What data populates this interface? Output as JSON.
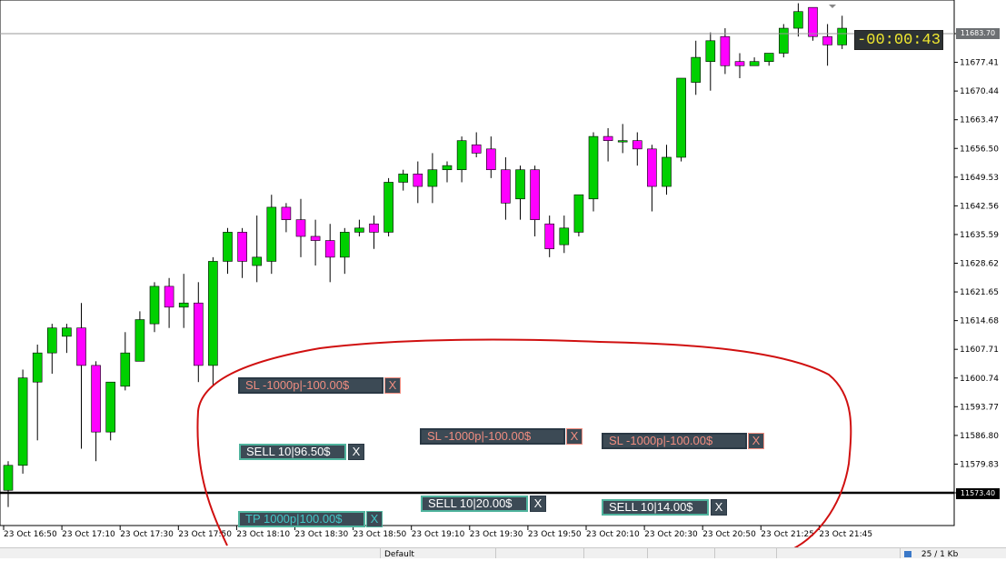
{
  "chart": {
    "price_ticks": [
      "11683.70",
      "11677.41",
      "11670.44",
      "11663.47",
      "11656.50",
      "11649.53",
      "11642.56",
      "11635.59",
      "11628.62",
      "11621.65",
      "11614.68",
      "11607.71",
      "11600.74",
      "11593.77",
      "11586.80",
      "11579.83",
      "11573.40"
    ],
    "time_ticks": [
      "23 Oct 16:50",
      "23 Oct 17:10",
      "23 Oct 17:30",
      "23 Oct 17:50",
      "23 Oct 18:10",
      "23 Oct 18:30",
      "23 Oct 18:50",
      "23 Oct 19:10",
      "23 Oct 19:30",
      "23 Oct 19:50",
      "23 Oct 20:10",
      "23 Oct 20:30",
      "23 Oct 20:50",
      "23 Oct 21:25",
      "23 Oct 21:45"
    ],
    "bid_price": "11683.70",
    "last_price": "11573.40",
    "countdown": "-00:00:43",
    "colors": {
      "bull": "#00d000",
      "bear": "#ff00ff",
      "annotation": "#d01010"
    }
  },
  "chart_data": {
    "type": "candlestick",
    "y_range": [
      11573.4,
      11683.7
    ],
    "candles": [
      {
        "o": 11574,
        "h": 11581,
        "l": 11570,
        "c": 11580
      },
      {
        "o": 11580,
        "h": 11603,
        "l": 11578,
        "c": 11601
      },
      {
        "o": 11600,
        "h": 11609,
        "l": 11586,
        "c": 11607
      },
      {
        "o": 11607,
        "h": 11614,
        "l": 11602,
        "c": 11613
      },
      {
        "o": 11611,
        "h": 11614,
        "l": 11607,
        "c": 11613
      },
      {
        "o": 11613,
        "h": 11619,
        "l": 11584,
        "c": 11604
      },
      {
        "o": 11604,
        "h": 11605,
        "l": 11581,
        "c": 11588
      },
      {
        "o": 11588,
        "h": 11600,
        "l": 11586,
        "c": 11600
      },
      {
        "o": 11599,
        "h": 11612,
        "l": 11598,
        "c": 11607
      },
      {
        "o": 11605,
        "h": 11617,
        "l": 11605,
        "c": 11615
      },
      {
        "o": 11614,
        "h": 11624,
        "l": 11612,
        "c": 11623
      },
      {
        "o": 11623,
        "h": 11625,
        "l": 11613,
        "c": 11618
      },
      {
        "o": 11618,
        "h": 11626,
        "l": 11613,
        "c": 11619
      },
      {
        "o": 11619,
        "h": 11624,
        "l": 11600,
        "c": 11604
      },
      {
        "o": 11604,
        "h": 11630,
        "l": 11599,
        "c": 11629
      },
      {
        "o": 11629,
        "h": 11637,
        "l": 11626,
        "c": 11636
      },
      {
        "o": 11636,
        "h": 11637,
        "l": 11625,
        "c": 11629
      },
      {
        "o": 11628,
        "h": 11640,
        "l": 11624,
        "c": 11630
      },
      {
        "o": 11629,
        "h": 11645,
        "l": 11626,
        "c": 11642
      },
      {
        "o": 11642,
        "h": 11643,
        "l": 11636,
        "c": 11639
      },
      {
        "o": 11639,
        "h": 11644,
        "l": 11630,
        "c": 11635
      },
      {
        "o": 11635,
        "h": 11639,
        "l": 11628,
        "c": 11634
      },
      {
        "o": 11634,
        "h": 11638,
        "l": 11624,
        "c": 11630
      },
      {
        "o": 11630,
        "h": 11637,
        "l": 11626,
        "c": 11636
      },
      {
        "o": 11636,
        "h": 11639,
        "l": 11635,
        "c": 11637
      },
      {
        "o": 11638,
        "h": 11640,
        "l": 11632,
        "c": 11636
      },
      {
        "o": 11636,
        "h": 11649,
        "l": 11635,
        "c": 11648
      },
      {
        "o": 11648,
        "h": 11651,
        "l": 11646,
        "c": 11650
      },
      {
        "o": 11650,
        "h": 11653,
        "l": 11643,
        "c": 11647
      },
      {
        "o": 11647,
        "h": 11655,
        "l": 11643,
        "c": 11651
      },
      {
        "o": 11651,
        "h": 11653,
        "l": 11648,
        "c": 11652
      },
      {
        "o": 11651,
        "h": 11659,
        "l": 11648,
        "c": 11658
      },
      {
        "o": 11657,
        "h": 11660,
        "l": 11654,
        "c": 11655
      },
      {
        "o": 11656,
        "h": 11659,
        "l": 11649,
        "c": 11651
      },
      {
        "o": 11651,
        "h": 11654,
        "l": 11639,
        "c": 11643
      },
      {
        "o": 11644,
        "h": 11652,
        "l": 11639,
        "c": 11651
      },
      {
        "o": 11651,
        "h": 11652,
        "l": 11635,
        "c": 11639
      },
      {
        "o": 11638,
        "h": 11640,
        "l": 11630,
        "c": 11632
      },
      {
        "o": 11633,
        "h": 11640,
        "l": 11631,
        "c": 11637
      },
      {
        "o": 11636,
        "h": 11645,
        "l": 11635,
        "c": 11645
      },
      {
        "o": 11644,
        "h": 11660,
        "l": 11641,
        "c": 11659
      },
      {
        "o": 11659,
        "h": 11661,
        "l": 11653,
        "c": 11658
      },
      {
        "o": 11658,
        "h": 11662,
        "l": 11655,
        "c": 11658
      },
      {
        "o": 11658,
        "h": 11660,
        "l": 11652,
        "c": 11656
      },
      {
        "o": 11656,
        "h": 11657,
        "l": 11641,
        "c": 11647
      },
      {
        "o": 11647,
        "h": 11657,
        "l": 11645,
        "c": 11654
      },
      {
        "o": 11654,
        "h": 11673,
        "l": 11653,
        "c": 11673
      },
      {
        "o": 11672,
        "h": 11682,
        "l": 11669,
        "c": 11678
      },
      {
        "o": 11677,
        "h": 11684,
        "l": 11670,
        "c": 11682
      },
      {
        "o": 11683,
        "h": 11685,
        "l": 11674,
        "c": 11676
      },
      {
        "o": 11677,
        "h": 11679,
        "l": 11673,
        "c": 11676
      },
      {
        "o": 11676,
        "h": 11678,
        "l": 11676,
        "c": 11677
      },
      {
        "o": 11677,
        "h": 11678,
        "l": 11676,
        "c": 11679
      },
      {
        "o": 11679,
        "h": 11686,
        "l": 11678,
        "c": 11685
      },
      {
        "o": 11685,
        "h": 11691,
        "l": 11683,
        "c": 11689
      },
      {
        "o": 11690,
        "h": 11690,
        "l": 11682,
        "c": 11683
      },
      {
        "o": 11683,
        "h": 11686,
        "l": 11676,
        "c": 11681
      },
      {
        "o": 11681,
        "h": 11688,
        "l": 11680,
        "c": 11685
      }
    ]
  },
  "overlays": {
    "sl_labels": [
      "SL -1000p|-100.00$",
      "SL -1000p|-100.00$",
      "SL -1000p|-100.00$"
    ],
    "sell_labels": [
      "SELL 10|96.50$",
      "SELL 10|20.00$",
      "SELL 10|14.00$"
    ],
    "tp_label": "TP 1000p|100.00$",
    "close_glyph": "X"
  },
  "statusbar": {
    "profile": "Default",
    "traffic": "25 / 1 Kb"
  }
}
